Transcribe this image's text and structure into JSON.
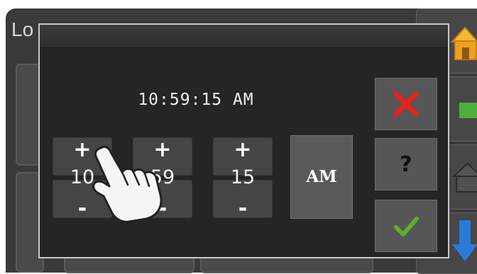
{
  "background": {
    "title": "Lo"
  },
  "dialog": {
    "time_display": "10:59:15 AM",
    "spinners": [
      {
        "name": "hour",
        "plus": "+",
        "minus": "-",
        "value": "10"
      },
      {
        "name": "minute",
        "plus": "+",
        "minus": "-",
        "value": "59"
      },
      {
        "name": "second",
        "plus": "+",
        "minus": "-",
        "value": "15"
      }
    ],
    "ampm_label": "AM",
    "help_label": "?"
  },
  "colors": {
    "cancel": "#e8201c",
    "confirm": "#5fae2b",
    "home_icon": "#f0a020",
    "side_green": "#4caf3a",
    "side_blue": "#2a7bd6"
  },
  "icons": {
    "cancel": "red-x-icon",
    "help": "question-mark-icon",
    "confirm": "green-check-icon",
    "home": "home-icon",
    "pointer": "pointing-hand-icon"
  }
}
